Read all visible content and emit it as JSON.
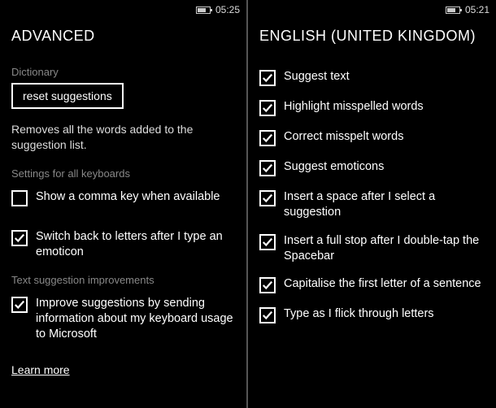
{
  "left": {
    "time": "05:25",
    "title": "ADVANCED",
    "dictionary_label": "Dictionary",
    "reset_button": "reset suggestions",
    "reset_desc": "Removes all the words added to the suggestion list.",
    "all_keyboards_label": "Settings for all keyboards",
    "comma_key": {
      "checked": false,
      "label": "Show a comma key when available"
    },
    "switch_back": {
      "checked": true,
      "label": "Switch back to letters after I type an emoticon"
    },
    "improvements_label": "Text suggestion improvements",
    "improve": {
      "checked": true,
      "label": "Improve suggestions by sending information about my keyboard usage to Microsoft"
    },
    "learn_more": "Learn more"
  },
  "right": {
    "time": "05:21",
    "title": "ENGLISH (UNITED KINGDOM)",
    "options": [
      {
        "checked": true,
        "label": "Suggest text"
      },
      {
        "checked": true,
        "label": "Highlight misspelled words"
      },
      {
        "checked": true,
        "label": "Correct misspelt words"
      },
      {
        "checked": true,
        "label": "Suggest emoticons"
      },
      {
        "checked": true,
        "label": "Insert a space after I select a suggestion"
      },
      {
        "checked": true,
        "label": "Insert a full stop after I double-tap the Spacebar"
      },
      {
        "checked": true,
        "label": "Capitalise the first letter of a sentence"
      },
      {
        "checked": true,
        "label": "Type as I flick through letters"
      }
    ]
  }
}
